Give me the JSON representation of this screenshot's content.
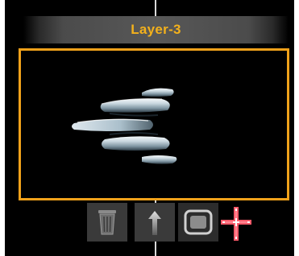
{
  "layer": {
    "title": "Layer-3"
  },
  "preview": {
    "content": "spaceship-sprite"
  },
  "toolbar": {
    "buttons": [
      {
        "name": "delete-layer",
        "icon": "trash-icon"
      },
      {
        "name": "move-layer-up",
        "icon": "arrow-up-icon"
      },
      {
        "name": "layer-frame",
        "icon": "rounded-square-icon"
      },
      {
        "name": "position-cursor",
        "icon": "crosshair-icon"
      }
    ]
  },
  "colors": {
    "accent": "#f0a11a",
    "title_text": "#f3b11c",
    "background": "#000000",
    "crosshair": "#ff5a6a"
  }
}
